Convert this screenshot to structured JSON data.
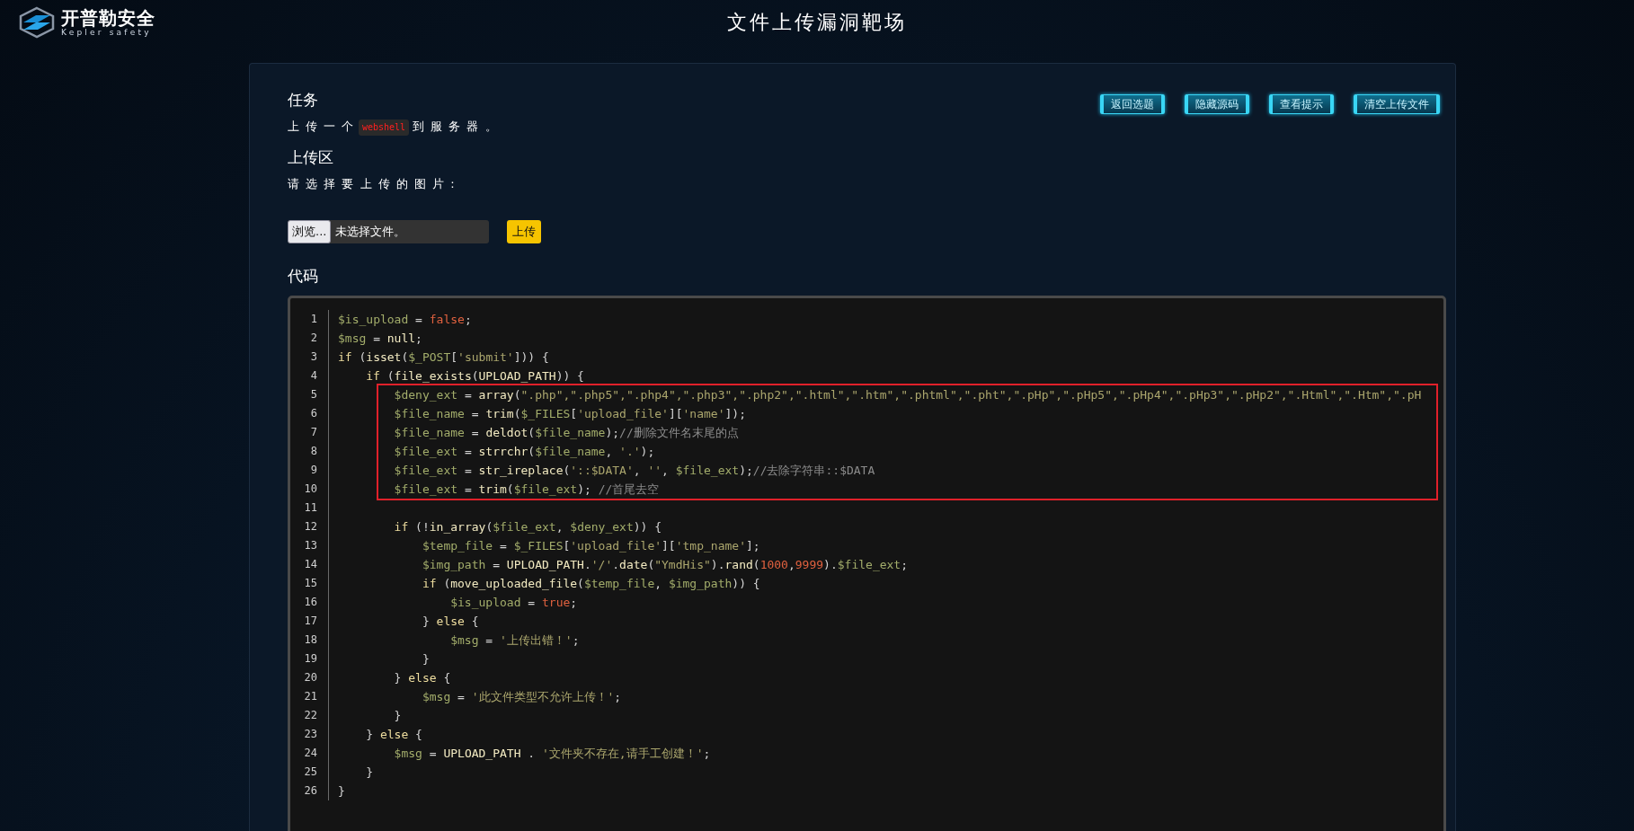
{
  "header": {
    "logo": {
      "name": "开普勒安全",
      "subtitle": "Kepler safety"
    },
    "title": "文件上传漏洞靶场"
  },
  "toolbar": {
    "buttons": [
      {
        "label": "返回选题"
      },
      {
        "label": "隐藏源码"
      },
      {
        "label": "查看提示"
      },
      {
        "label": "清空上传文件"
      }
    ]
  },
  "task": {
    "heading": "任务",
    "before": "上 传 一 个",
    "code": "webshell",
    "after": "到 服 务 器 。"
  },
  "upload": {
    "heading": "上传区",
    "prompt": "请 选 择 要 上 传 的 图 片 :",
    "browse_button": "浏览...",
    "file_status": "未选择文件。",
    "submit_button": "上传"
  },
  "code": {
    "heading": "代码",
    "lines": [
      {
        "number": "1",
        "highlighted": false,
        "tokens": [
          {
            "kind": "var",
            "text": "$is_upload"
          },
          {
            "kind": "punct",
            "text": " = "
          },
          {
            "kind": "literal",
            "text": "false"
          },
          {
            "kind": "punct",
            "text": ";"
          }
        ]
      },
      {
        "number": "2",
        "highlighted": false,
        "tokens": [
          {
            "kind": "var",
            "text": "$msg"
          },
          {
            "kind": "punct",
            "text": " = "
          },
          {
            "kind": "func",
            "text": "null"
          },
          {
            "kind": "punct",
            "text": ";"
          }
        ]
      },
      {
        "number": "3",
        "highlighted": false,
        "tokens": [
          {
            "kind": "keyword",
            "text": "if"
          },
          {
            "kind": "punct",
            "text": " ("
          },
          {
            "kind": "func",
            "text": "isset"
          },
          {
            "kind": "punct",
            "text": "("
          },
          {
            "kind": "var",
            "text": "$_POST"
          },
          {
            "kind": "punct",
            "text": "["
          },
          {
            "kind": "string",
            "text": "'submit'"
          },
          {
            "kind": "punct",
            "text": "])) {"
          }
        ],
        "children": [
          {
            "number": "4",
            "highlighted": false,
            "tokens": [
              {
                "kind": "keyword",
                "text": "if"
              },
              {
                "kind": "punct",
                "text": " ("
              },
              {
                "kind": "func",
                "text": "file_exists"
              },
              {
                "kind": "punct",
                "text": "("
              },
              {
                "kind": "func",
                "text": "UPLOAD_PATH"
              },
              {
                "kind": "punct",
                "text": ")) {"
              }
            ],
            "children": [
              {
                "number": "5",
                "highlighted": true,
                "tokens": [
                  {
                    "kind": "var",
                    "text": "$deny_ext"
                  },
                  {
                    "kind": "punct",
                    "text": " = "
                  },
                  {
                    "kind": "func",
                    "text": "array"
                  },
                  {
                    "kind": "punct",
                    "text": "("
                  },
                  {
                    "kind": "string",
                    "text": "\".php\",\".php5\",\".php4\",\".php3\",\".php2\",\".html\",\".htm\",\".phtml\",\".pht\",\".pHp\",\".pHp5\",\".pHp4\",\".pHp3\",\".pHp2\",\".Html\",\".Htm\",\".pH"
                  }
                ]
              },
              {
                "number": "6",
                "highlighted": true,
                "tokens": [
                  {
                    "kind": "var",
                    "text": "$file_name"
                  },
                  {
                    "kind": "punct",
                    "text": " = "
                  },
                  {
                    "kind": "func",
                    "text": "trim"
                  },
                  {
                    "kind": "punct",
                    "text": "("
                  },
                  {
                    "kind": "var",
                    "text": "$_FILES"
                  },
                  {
                    "kind": "punct",
                    "text": "["
                  },
                  {
                    "kind": "string",
                    "text": "'upload_file'"
                  },
                  {
                    "kind": "punct",
                    "text": "]["
                  },
                  {
                    "kind": "string",
                    "text": "'name'"
                  },
                  {
                    "kind": "punct",
                    "text": "]);"
                  }
                ]
              },
              {
                "number": "7",
                "highlighted": true,
                "tokens": [
                  {
                    "kind": "var",
                    "text": "$file_name"
                  },
                  {
                    "kind": "punct",
                    "text": " = "
                  },
                  {
                    "kind": "func",
                    "text": "deldot"
                  },
                  {
                    "kind": "punct",
                    "text": "("
                  },
                  {
                    "kind": "var",
                    "text": "$file_name"
                  },
                  {
                    "kind": "punct",
                    "text": ");"
                  },
                  {
                    "kind": "comment",
                    "text": "//删除文件名末尾的点"
                  }
                ]
              },
              {
                "number": "8",
                "highlighted": true,
                "tokens": [
                  {
                    "kind": "var",
                    "text": "$file_ext"
                  },
                  {
                    "kind": "punct",
                    "text": " = "
                  },
                  {
                    "kind": "func",
                    "text": "strrchr"
                  },
                  {
                    "kind": "punct",
                    "text": "("
                  },
                  {
                    "kind": "var",
                    "text": "$file_name"
                  },
                  {
                    "kind": "punct",
                    "text": ", "
                  },
                  {
                    "kind": "string",
                    "text": "'.'"
                  },
                  {
                    "kind": "punct",
                    "text": ");"
                  }
                ]
              },
              {
                "number": "9",
                "highlighted": true,
                "tokens": [
                  {
                    "kind": "var",
                    "text": "$file_ext"
                  },
                  {
                    "kind": "punct",
                    "text": " = "
                  },
                  {
                    "kind": "func",
                    "text": "str_ireplace"
                  },
                  {
                    "kind": "punct",
                    "text": "("
                  },
                  {
                    "kind": "string",
                    "text": "'::$DATA'"
                  },
                  {
                    "kind": "punct",
                    "text": ", "
                  },
                  {
                    "kind": "string",
                    "text": "''"
                  },
                  {
                    "kind": "punct",
                    "text": ", "
                  },
                  {
                    "kind": "var",
                    "text": "$file_ext"
                  },
                  {
                    "kind": "punct",
                    "text": ");"
                  },
                  {
                    "kind": "comment",
                    "text": "//去除字符串::$DATA"
                  }
                ]
              },
              {
                "number": "10",
                "highlighted": true,
                "tokens": [
                  {
                    "kind": "var",
                    "text": "$file_ext"
                  },
                  {
                    "kind": "punct",
                    "text": " = "
                  },
                  {
                    "kind": "func",
                    "text": "trim"
                  },
                  {
                    "kind": "punct",
                    "text": "("
                  },
                  {
                    "kind": "var",
                    "text": "$file_ext"
                  },
                  {
                    "kind": "punct",
                    "text": "); "
                  },
                  {
                    "kind": "comment",
                    "text": "//首尾去空"
                  }
                ]
              },
              {
                "number": "11",
                "highlighted": false
              },
              {
                "number": "12",
                "highlighted": false,
                "tokens": [
                  {
                    "kind": "keyword",
                    "text": "if"
                  },
                  {
                    "kind": "punct",
                    "text": " (!"
                  },
                  {
                    "kind": "func",
                    "text": "in_array"
                  },
                  {
                    "kind": "punct",
                    "text": "("
                  },
                  {
                    "kind": "var",
                    "text": "$file_ext"
                  },
                  {
                    "kind": "punct",
                    "text": ", "
                  },
                  {
                    "kind": "var",
                    "text": "$deny_ext"
                  },
                  {
                    "kind": "punct",
                    "text": ")) {"
                  }
                ],
                "children": [
                  {
                    "number": "13",
                    "highlighted": false,
                    "tokens": [
                      {
                        "kind": "var",
                        "text": "$temp_file"
                      },
                      {
                        "kind": "punct",
                        "text": " = "
                      },
                      {
                        "kind": "var",
                        "text": "$_FILES"
                      },
                      {
                        "kind": "punct",
                        "text": "["
                      },
                      {
                        "kind": "string",
                        "text": "'upload_file'"
                      },
                      {
                        "kind": "punct",
                        "text": "]["
                      },
                      {
                        "kind": "string",
                        "text": "'tmp_name'"
                      },
                      {
                        "kind": "punct",
                        "text": "];"
                      }
                    ]
                  },
                  {
                    "number": "14",
                    "highlighted": false,
                    "tokens": [
                      {
                        "kind": "var",
                        "text": "$img_path"
                      },
                      {
                        "kind": "punct",
                        "text": " = "
                      },
                      {
                        "kind": "func",
                        "text": "UPLOAD_PATH"
                      },
                      {
                        "kind": "punct",
                        "text": "."
                      },
                      {
                        "kind": "string",
                        "text": "'/'"
                      },
                      {
                        "kind": "punct",
                        "text": "."
                      },
                      {
                        "kind": "func",
                        "text": "date"
                      },
                      {
                        "kind": "punct",
                        "text": "("
                      },
                      {
                        "kind": "string",
                        "text": "\"YmdHis\""
                      },
                      {
                        "kind": "punct",
                        "text": ")."
                      },
                      {
                        "kind": "func",
                        "text": "rand"
                      },
                      {
                        "kind": "punct",
                        "text": "("
                      },
                      {
                        "kind": "literal",
                        "text": "1000"
                      },
                      {
                        "kind": "punct",
                        "text": ","
                      },
                      {
                        "kind": "literal",
                        "text": "9999"
                      },
                      {
                        "kind": "punct",
                        "text": ")."
                      },
                      {
                        "kind": "var",
                        "text": "$file_ext"
                      },
                      {
                        "kind": "punct",
                        "text": ";"
                      }
                    ]
                  },
                  {
                    "number": "15",
                    "highlighted": false,
                    "tokens": [
                      {
                        "kind": "keyword",
                        "text": "if"
                      },
                      {
                        "kind": "punct",
                        "text": " ("
                      },
                      {
                        "kind": "func",
                        "text": "move_uploaded_file"
                      },
                      {
                        "kind": "punct",
                        "text": "("
                      },
                      {
                        "kind": "var",
                        "text": "$temp_file"
                      },
                      {
                        "kind": "punct",
                        "text": ", "
                      },
                      {
                        "kind": "var",
                        "text": "$img_path"
                      },
                      {
                        "kind": "punct",
                        "text": ")) {"
                      }
                    ],
                    "children": [
                      {
                        "number": "16",
                        "highlighted": false,
                        "tokens": [
                          {
                            "kind": "var",
                            "text": "$is_upload"
                          },
                          {
                            "kind": "punct",
                            "text": " = "
                          },
                          {
                            "kind": "literal",
                            "text": "true"
                          },
                          {
                            "kind": "punct",
                            "text": ";"
                          }
                        ]
                      }
                    ]
                  },
                  {
                    "number": "17",
                    "highlighted": false,
                    "tokens": [
                      {
                        "kind": "punct",
                        "text": "} "
                      },
                      {
                        "kind": "keyword",
                        "text": "else"
                      },
                      {
                        "kind": "punct",
                        "text": " {"
                      }
                    ],
                    "children": [
                      {
                        "number": "18",
                        "highlighted": false,
                        "tokens": [
                          {
                            "kind": "var",
                            "text": "$msg"
                          },
                          {
                            "kind": "punct",
                            "text": " = "
                          },
                          {
                            "kind": "string",
                            "text": "'上传出错！'"
                          },
                          {
                            "kind": "punct",
                            "text": ";"
                          }
                        ]
                      }
                    ]
                  },
                  {
                    "number": "19",
                    "highlighted": false,
                    "tokens": [
                      {
                        "kind": "punct",
                        "text": "}"
                      }
                    ]
                  }
                ]
              },
              {
                "number": "20",
                "highlighted": false,
                "tokens": [
                  {
                    "kind": "punct",
                    "text": "} "
                  },
                  {
                    "kind": "keyword",
                    "text": "else"
                  },
                  {
                    "kind": "punct",
                    "text": " {"
                  }
                ],
                "children": [
                  {
                    "number": "21",
                    "highlighted": false,
                    "tokens": [
                      {
                        "kind": "var",
                        "text": "$msg"
                      },
                      {
                        "kind": "punct",
                        "text": " = "
                      },
                      {
                        "kind": "string",
                        "text": "'此文件类型不允许上传！'"
                      },
                      {
                        "kind": "punct",
                        "text": ";"
                      }
                    ]
                  }
                ]
              },
              {
                "number": "22",
                "highlighted": false,
                "tokens": [
                  {
                    "kind": "punct",
                    "text": "}"
                  }
                ]
              }
            ]
          },
          {
            "number": "23",
            "highlighted": false,
            "tokens": [
              {
                "kind": "punct",
                "text": "} "
              },
              {
                "kind": "keyword",
                "text": "else"
              },
              {
                "kind": "punct",
                "text": " {"
              }
            ],
            "children": [
              {
                "number": "24",
                "highlighted": false,
                "tokens": [
                  {
                    "kind": "var",
                    "text": "$msg"
                  },
                  {
                    "kind": "punct",
                    "text": " = "
                  },
                  {
                    "kind": "func",
                    "text": "UPLOAD_PATH"
                  },
                  {
                    "kind": "punct",
                    "text": " . "
                  },
                  {
                    "kind": "string",
                    "text": "'文件夹不存在,请手工创建！'"
                  },
                  {
                    "kind": "punct",
                    "text": ";"
                  }
                ]
              }
            ]
          },
          {
            "number": "25",
            "highlighted": false,
            "tokens": [
              {
                "kind": "punct",
                "text": "}"
              }
            ]
          }
        ]
      },
      {
        "number": "26",
        "highlighted": false,
        "tokens": [
          {
            "kind": "punct",
            "text": "}"
          }
        ]
      }
    ]
  }
}
